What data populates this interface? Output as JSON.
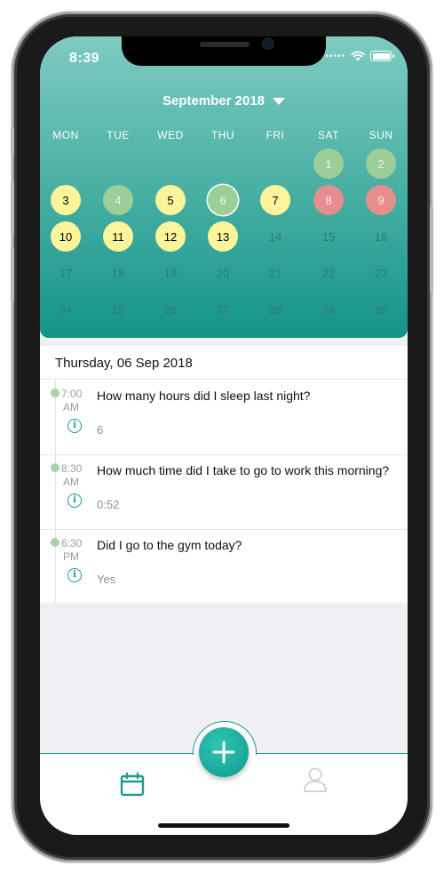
{
  "status": {
    "time": "8:39",
    "carrier_dots": "•••••"
  },
  "calendar": {
    "month_label": "September 2018",
    "weekdays": [
      "MON",
      "TUE",
      "WED",
      "THU",
      "FRI",
      "SAT",
      "SUN"
    ],
    "rows": [
      [
        {
          "day": "",
          "state": "none"
        },
        {
          "day": "",
          "state": "none"
        },
        {
          "day": "",
          "state": "none"
        },
        {
          "day": "",
          "state": "none"
        },
        {
          "day": "",
          "state": "none"
        },
        {
          "day": "1",
          "state": "green"
        },
        {
          "day": "2",
          "state": "green"
        }
      ],
      [
        {
          "day": "3",
          "state": "yellow"
        },
        {
          "day": "4",
          "state": "green"
        },
        {
          "day": "5",
          "state": "yellow"
        },
        {
          "day": "6",
          "state": "selected"
        },
        {
          "day": "7",
          "state": "yellow"
        },
        {
          "day": "8",
          "state": "red"
        },
        {
          "day": "9",
          "state": "red"
        }
      ],
      [
        {
          "day": "10",
          "state": "yellow"
        },
        {
          "day": "11",
          "state": "yellow"
        },
        {
          "day": "12",
          "state": "yellow"
        },
        {
          "day": "13",
          "state": "yellow"
        },
        {
          "day": "14",
          "state": "none"
        },
        {
          "day": "15",
          "state": "none"
        },
        {
          "day": "16",
          "state": "none"
        }
      ],
      [
        {
          "day": "17",
          "state": "none"
        },
        {
          "day": "18",
          "state": "none"
        },
        {
          "day": "19",
          "state": "none"
        },
        {
          "day": "20",
          "state": "none"
        },
        {
          "day": "21",
          "state": "none"
        },
        {
          "day": "22",
          "state": "none"
        },
        {
          "day": "23",
          "state": "none"
        }
      ],
      [
        {
          "day": "24",
          "state": "none"
        },
        {
          "day": "25",
          "state": "none"
        },
        {
          "day": "26",
          "state": "none"
        },
        {
          "day": "27",
          "state": "none"
        },
        {
          "day": "28",
          "state": "none"
        },
        {
          "day": "29",
          "state": "none"
        },
        {
          "day": "30",
          "state": "none"
        }
      ]
    ]
  },
  "entries": {
    "date_title": "Thursday, 06 Sep 2018",
    "items": [
      {
        "time": "7:00",
        "period": "AM",
        "question": "How many hours did I sleep last night?",
        "answer": "6",
        "icon": "info-icon"
      },
      {
        "time": "8:30",
        "period": "AM",
        "question": "How much time did I take to go to work this morning?",
        "answer": "0:52",
        "icon": "info-icon"
      },
      {
        "time": "6:30",
        "period": "PM",
        "question": "Did I go to the gym today?",
        "answer": "Yes",
        "icon": "info-icon"
      }
    ]
  },
  "tabbar": {
    "calendar_icon": "calendar-icon",
    "add_icon": "plus-icon",
    "profile_icon": "user-icon"
  },
  "colors": {
    "accent": "#1c9b8f",
    "yellow_day": "#fdf39a",
    "green_day": "#9ccf98",
    "red_day": "#e68d8e"
  }
}
